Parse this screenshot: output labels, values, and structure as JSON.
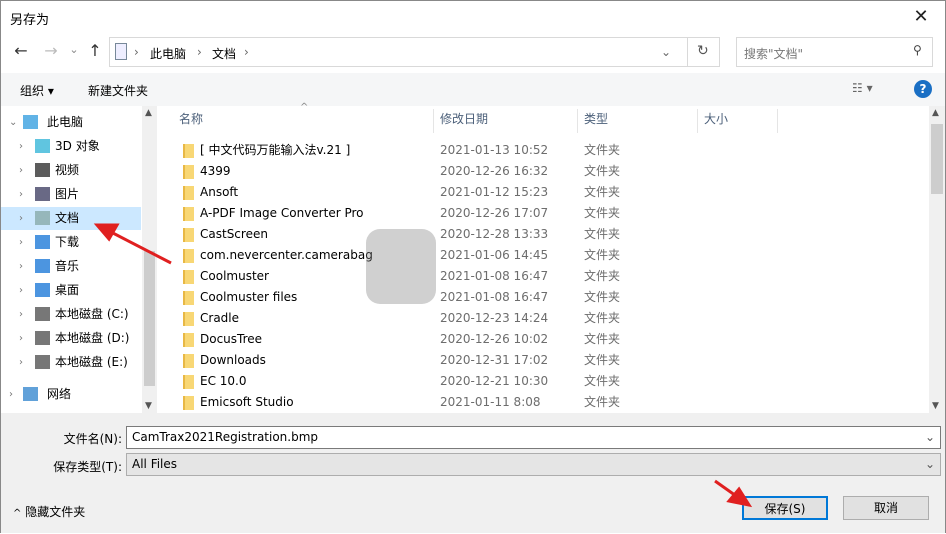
{
  "window": {
    "title": "另存为",
    "close_icon": "close-icon"
  },
  "nav": {
    "back": "←",
    "forward": "→",
    "recent": "⌄",
    "up": "↑"
  },
  "address": {
    "crumbs": [
      "此电脑",
      "文档"
    ],
    "search_placeholder": "搜索\"文档\""
  },
  "toolbar": {
    "organize": "组织 ▾",
    "new_folder": "新建文件夹",
    "help": "?"
  },
  "sidebar": {
    "items": [
      {
        "label": "此电脑",
        "icon": "computer-icon",
        "expanded": true
      },
      {
        "label": "3D 对象",
        "icon": "3d-objects-icon"
      },
      {
        "label": "视频",
        "icon": "video-icon"
      },
      {
        "label": "图片",
        "icon": "pictures-icon"
      },
      {
        "label": "文档",
        "icon": "documents-icon",
        "selected": true
      },
      {
        "label": "下载",
        "icon": "download-icon"
      },
      {
        "label": "音乐",
        "icon": "music-icon"
      },
      {
        "label": "桌面",
        "icon": "desktop-icon"
      },
      {
        "label": "本地磁盘 (C:)",
        "icon": "drive-icon"
      },
      {
        "label": "本地磁盘 (D:)",
        "icon": "drive-icon"
      },
      {
        "label": "本地磁盘 (E:)",
        "icon": "drive-icon"
      },
      {
        "label": "网络",
        "icon": "network-icon"
      }
    ]
  },
  "columns": [
    "名称",
    "修改日期",
    "类型",
    "大小"
  ],
  "files": [
    {
      "name": "[ 中文代码万能输入法v.21 ]",
      "date": "2021-01-13 10:52",
      "type": "文件夹"
    },
    {
      "name": "4399",
      "date": "2020-12-26 16:32",
      "type": "文件夹"
    },
    {
      "name": "Ansoft",
      "date": "2021-01-12 15:23",
      "type": "文件夹"
    },
    {
      "name": "A-PDF Image Converter Pro",
      "date": "2020-12-26 17:07",
      "type": "文件夹"
    },
    {
      "name": "CastScreen",
      "date": "2020-12-28 13:33",
      "type": "文件夹"
    },
    {
      "name": "com.nevercenter.camerabag",
      "date": "2021-01-06 14:45",
      "type": "文件夹"
    },
    {
      "name": "Coolmuster",
      "date": "2021-01-08 16:47",
      "type": "文件夹"
    },
    {
      "name": "Coolmuster files",
      "date": "2021-01-08 16:47",
      "type": "文件夹"
    },
    {
      "name": "Cradle",
      "date": "2020-12-23 14:24",
      "type": "文件夹"
    },
    {
      "name": "DocusTree",
      "date": "2020-12-26 10:02",
      "type": "文件夹"
    },
    {
      "name": "Downloads",
      "date": "2020-12-31 17:02",
      "type": "文件夹"
    },
    {
      "name": "EC 10.0",
      "date": "2020-12-21 10:30",
      "type": "文件夹"
    },
    {
      "name": "Emicsoft Studio",
      "date": "2021-01-11 8:08",
      "type": "文件夹"
    }
  ],
  "form": {
    "filename_label": "文件名(N):",
    "filename_value": "CamTrax2021Registration.bmp",
    "filetype_label": "保存类型(T):",
    "filetype_value": "All Files"
  },
  "footer": {
    "hide_folders": "隐藏文件夹",
    "save": "保存(S)",
    "cancel": "取消"
  },
  "colors": {
    "selection": "#cce8ff",
    "accent": "#0078d7",
    "annotation_arrow": "#e02020"
  }
}
